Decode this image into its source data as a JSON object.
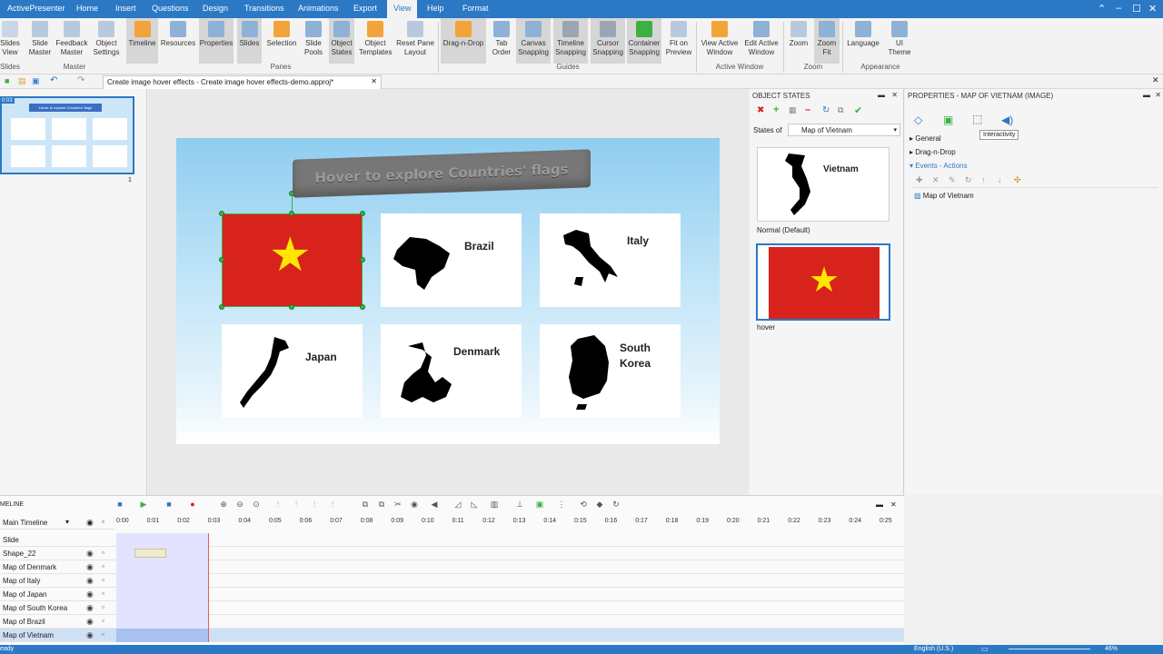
{
  "app": {
    "name": "ActivePresenter"
  },
  "menu": {
    "items": [
      "Home",
      "Insert",
      "Questions",
      "Design",
      "Transitions",
      "Animations",
      "Export",
      "View",
      "Help",
      "Format"
    ],
    "active": "View"
  },
  "ribbon": {
    "slides_label": "Slides\nView",
    "slide_master": "Slide\nMaster",
    "feedback_master": "Feedback\nMaster",
    "object_settings": "Object\nSettings",
    "timeline": "Timeline",
    "resources": "Resources",
    "properties": "Properties",
    "slides": "Slides",
    "selection": "Selection",
    "slide_pools": "Slide\nPools",
    "object_states": "Object\nStates",
    "object_templates": "Object\nTemplates",
    "reset_pane_layout": "Reset Pane\nLayout",
    "drag_n_drop": "Drag-n-Drop",
    "tab_order": "Tab\nOrder",
    "canvas_snapping": "Canvas\nSnapping",
    "timeline_snapping": "Timeline\nSnapping",
    "cursor_snapping": "Cursor\nSnapping",
    "container_snapping": "Container\nSnapping",
    "fit_on_preview": "Fit on\nPreview",
    "view_active_window": "View Active\nWindow",
    "edit_active_window": "Edit Active\nWindow",
    "zoom": "Zoom",
    "zoom_fit": "Zoom\nFit",
    "language": "Language",
    "ui_theme": "UI\nTheme",
    "groups": {
      "slides": "Slides",
      "master": "Master",
      "panes": "Panes",
      "guides": "Guides",
      "active_window": "Active Window",
      "zoom": "Zoom",
      "appearance": "Appearance"
    }
  },
  "document": {
    "tab_title": "Create image hover effects - Create image hover effects-demo.approj*",
    "thumb_time": "0:03",
    "thumb_number": "1",
    "thumb_title": "Hover to explore Countries' flags"
  },
  "slide": {
    "banner": "Hover to explore Countries' flags",
    "cards": [
      {
        "name": "Vietnam",
        "label": ""
      },
      {
        "name": "Brazil",
        "label": "Brazil"
      },
      {
        "name": "Italy",
        "label": "Italy"
      },
      {
        "name": "Japan",
        "label": "Japan"
      },
      {
        "name": "Denmark",
        "label": "Denmark"
      },
      {
        "name": "South Korea",
        "label": "South\nKorea"
      }
    ],
    "star": "★"
  },
  "object_states": {
    "title": "OBJECT STATES",
    "states_of_label": "States of",
    "states_of_value": "Map of Vietnam",
    "state1_label": "Normal (Default)",
    "state1_text": "Vietnam",
    "state2_label": "hover"
  },
  "properties": {
    "title": "PROPERTIES - MAP OF VIETNAM (IMAGE)",
    "tooltip": "Interactivity",
    "sections": [
      "General",
      "Drag-n-Drop",
      "Events - Actions"
    ],
    "event_item": "Map of Vietnam"
  },
  "timeline": {
    "title": "MELINE",
    "main": "Main Timeline",
    "ticks": [
      "0:00",
      "0:01",
      "0:02",
      "0:03",
      "0:04",
      "0:05",
      "0:06",
      "0:07",
      "0:08",
      "0:09",
      "0:10",
      "0:11",
      "0:12",
      "0:13",
      "0:14",
      "0:15",
      "0:16",
      "0:17",
      "0:18",
      "0:19",
      "0:20",
      "0:21",
      "0:22",
      "0:23",
      "0:24",
      "0:25"
    ],
    "rows": [
      "Slide",
      "Shape_22",
      "Map of Denmark",
      "Map of Italy",
      "Map of Japan",
      "Map of South Korea",
      "Map of Brazil",
      "Map of Vietnam"
    ]
  },
  "status": {
    "left": "eady",
    "language": "English (U.S.)",
    "zoom": "46%"
  },
  "colors": {
    "accent": "#2b78c5",
    "vn_red": "#d8221c",
    "vn_star": "#ffe600",
    "selection": "#3cb043"
  }
}
